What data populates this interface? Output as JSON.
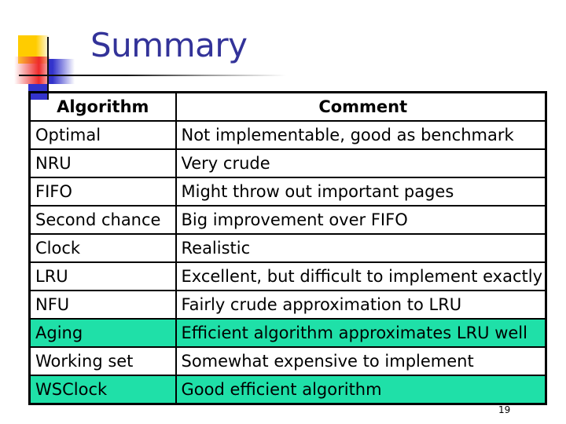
{
  "slide": {
    "title": "Summary",
    "page_number": "19",
    "highlight_color": "#1fe0a8",
    "title_color": "#333399"
  },
  "table": {
    "headers": [
      "Algorithm",
      "Comment"
    ],
    "rows": [
      {
        "algorithm": "Optimal",
        "comment": "Not implementable, good as benchmark",
        "highlighted": false
      },
      {
        "algorithm": "NRU",
        "comment": "Very crude",
        "highlighted": false
      },
      {
        "algorithm": "FIFO",
        "comment": "Might throw out important pages",
        "highlighted": false
      },
      {
        "algorithm": "Second chance",
        "comment": "Big improvement over FIFO",
        "highlighted": false
      },
      {
        "algorithm": "Clock",
        "comment": "Realistic",
        "highlighted": false
      },
      {
        "algorithm": "LRU",
        "comment": "Excellent, but difficult to implement exactly",
        "highlighted": false
      },
      {
        "algorithm": "NFU",
        "comment": "Fairly crude approximation to LRU",
        "highlighted": false
      },
      {
        "algorithm": "Aging",
        "comment": "Efficient algorithm approximates LRU well",
        "highlighted": true
      },
      {
        "algorithm": "Working set",
        "comment": "Somewhat expensive to implement",
        "highlighted": false
      },
      {
        "algorithm": "WSClock",
        "comment": "Good efficient algorithm",
        "highlighted": true
      }
    ]
  }
}
